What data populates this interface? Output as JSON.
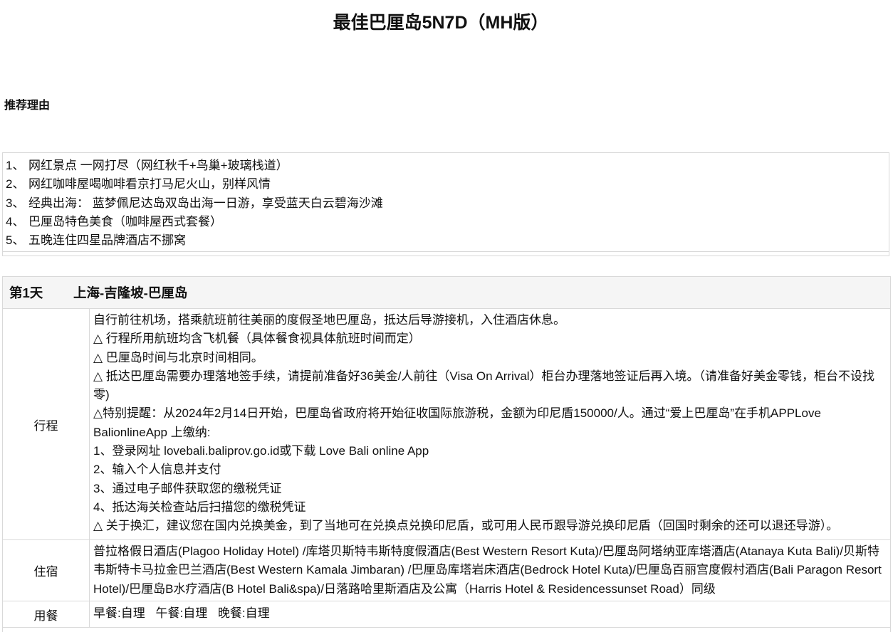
{
  "title": "最佳巴厘岛5N7D（MH版）",
  "recommend": {
    "heading": "推荐理由",
    "items": [
      {
        "num": "1、",
        "text": "网红景点 一网打尽（网红秋千+鸟巢+玻璃栈道）"
      },
      {
        "num": "2、",
        "text": "网红咖啡屋喝咖啡看京打马尼火山，别样风情"
      },
      {
        "num": "3、",
        "text": "经典出海： 蓝梦佩尼达岛双岛出海一日游，享受蓝天白云碧海沙滩"
      },
      {
        "num": "4、",
        "text": "巴厘岛特色美食（咖啡屋西式套餐）"
      },
      {
        "num": "5、",
        "text": "五晚连住四星品牌酒店不挪窝"
      }
    ]
  },
  "day1": {
    "day_label": "第1天",
    "route": "上海-吉隆坡-巴厘岛",
    "itinerary_label": "行程",
    "itinerary_lines": [
      "自行前往机场，搭乘航班前往美丽的度假圣地巴厘岛，抵达后导游接机，入住酒店休息。",
      "△ 行程所用航班均含飞机餐（具体餐食视具体航班时间而定）",
      "△ 巴厘岛时间与北京时间相同。",
      "△ 抵达巴厘岛需要办理落地签手续，请提前准备好36美金/人前往（Visa On Arrival）柜台办理落地签证后再入境。（请准备好美金零钱，柜台不设找零)",
      "△特别提醒：从2024年2月14日开始，巴厘岛省政府将开始征收国际旅游税，金额为印尼盾150000/人。通过“爱上巴厘岛”在手机APPLove BalionlineApp 上缴纳:",
      "1、登录网址 lovebali.baliprov.go.id或下载 Love Bali online App",
      "2、输入个人信息并支付",
      "3、通过电子邮件获取您的缴税凭证",
      "4、抵达海关检查站后扫描您的缴税凭证",
      "△ 关于换汇，建议您在国内兑换美金，到了当地可在兑换点兑换印尼盾，或可用人民币跟导游兑换印尼盾（回国时剩余的还可以退还导游）。"
    ],
    "hotel_label": "住宿",
    "hotel_text": "普拉格假日酒店(Plagoo Holiday Hotel) /库塔贝斯特韦斯特度假酒店(Best Western Resort Kuta)/巴厘岛阿塔纳亚库塔酒店(Atanaya Kuta Bali)/贝斯特韦斯特卡马拉金巴兰酒店(Best Western Kamala Jimbaran) /巴厘岛库塔岩床酒店(Bedrock Hotel Kuta)/巴厘岛百丽宫度假村酒店(Bali Paragon Resort Hotel)/巴厘岛B水疗酒店(B Hotel Bali&spa)/日落路哈里斯酒店及公寓（Harris Hotel & Residencessunset Road）同级",
    "meals_label": "用餐",
    "breakfast": "早餐:自理",
    "lunch": "午餐:自理",
    "dinner": "晚餐:自理"
  }
}
